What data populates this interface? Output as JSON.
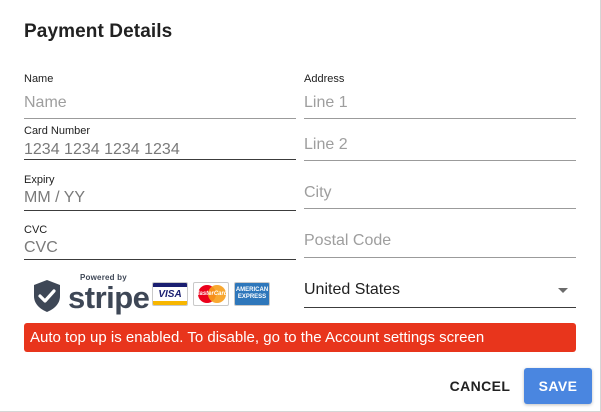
{
  "dialog": {
    "title": "Payment Details"
  },
  "left": {
    "name": {
      "label": "Name",
      "placeholder": "Name"
    },
    "card_number": {
      "label": "Card Number",
      "value": "1234 1234 1234 1234"
    },
    "expiry": {
      "label": "Expiry",
      "value": "MM / YY"
    },
    "cvc": {
      "label": "CVC",
      "value": "CVC"
    }
  },
  "right": {
    "section_label": "Address",
    "line1": {
      "placeholder": "Line 1"
    },
    "line2": {
      "placeholder": "Line 2"
    },
    "city": {
      "placeholder": "City"
    },
    "postal": {
      "placeholder": "Postal Code"
    },
    "country": {
      "selected": "United States"
    }
  },
  "badge": {
    "powered_by": "Powered by",
    "brand": "stripe",
    "cards": [
      "VISA",
      "MasterCard",
      "AMERICAN EXPRESS"
    ]
  },
  "alert": {
    "text": "Auto top up is enabled. To disable, go to the Account settings screen",
    "color": "#e8351c"
  },
  "actions": {
    "cancel_label": "CANCEL",
    "save_label": "SAVE",
    "save_color": "#4a86e0"
  }
}
